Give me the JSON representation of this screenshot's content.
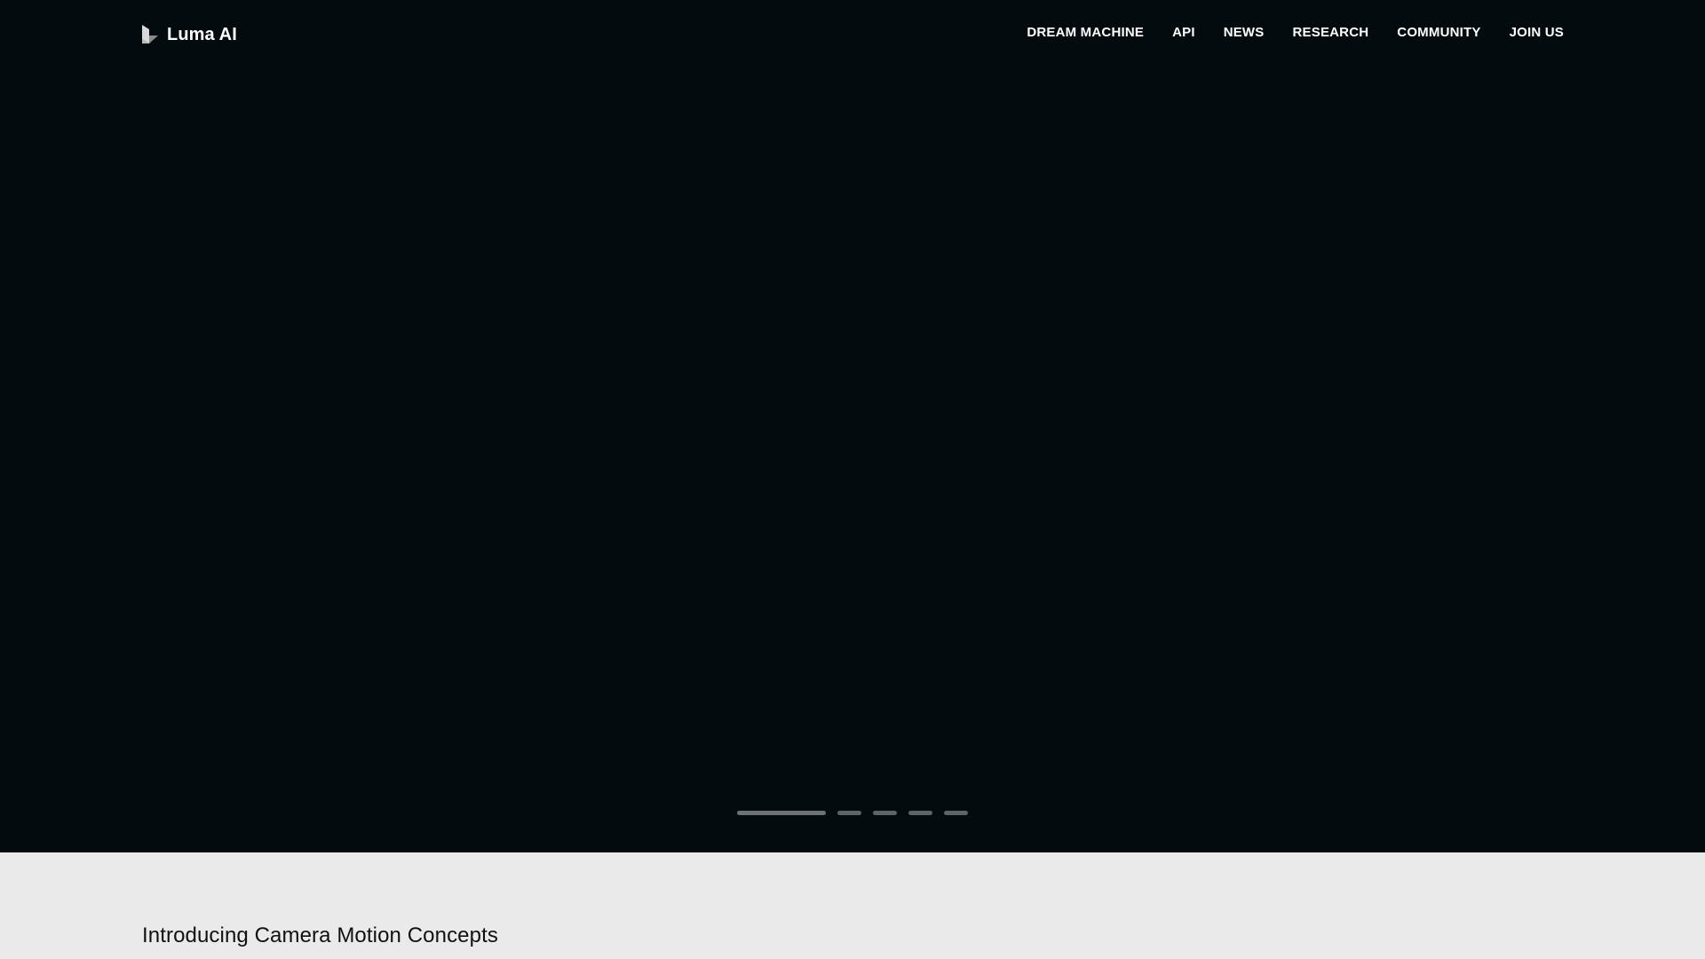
{
  "brand": {
    "name": "Luma AI",
    "logo_icon": "luma-cube-icon"
  },
  "nav": {
    "items": [
      {
        "label": "DREAM MACHINE"
      },
      {
        "label": "API"
      },
      {
        "label": "NEWS"
      },
      {
        "label": "RESEARCH"
      },
      {
        "label": "COMMUNITY"
      },
      {
        "label": "JOIN US"
      }
    ]
  },
  "hero": {
    "background": "#030b0e",
    "indicators": {
      "count": 5,
      "active_index": 0
    }
  },
  "intro": {
    "title": "Introducing Camera Motion Concepts",
    "background": "#eaeaea"
  }
}
